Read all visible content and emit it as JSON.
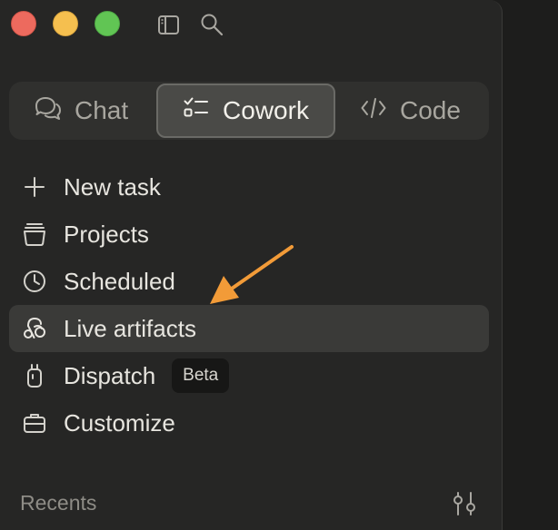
{
  "window": {
    "traffic_lights": {
      "close": "close",
      "minimize": "minimize",
      "zoom": "zoom"
    },
    "top_icons": [
      "sidebar-toggle-icon",
      "search-icon"
    ]
  },
  "modes": {
    "chat_label": "Chat",
    "cowork_label": "Cowork",
    "code_label": "Code",
    "active": "Cowork"
  },
  "nav": {
    "items": [
      {
        "label": "New task",
        "icon": "plus-icon"
      },
      {
        "label": "Projects",
        "icon": "folder-icon"
      },
      {
        "label": "Scheduled",
        "icon": "clock-icon"
      },
      {
        "label": "Live artifacts",
        "icon": "live-artifacts-icon",
        "active": true
      },
      {
        "label": "Dispatch",
        "icon": "device-icon",
        "badge": "Beta"
      },
      {
        "label": "Customize",
        "icon": "briefcase-icon"
      }
    ]
  },
  "recents": {
    "label": "Recents",
    "filter_icon": "filter-icon"
  },
  "colors": {
    "sidebar_bg": "#262625",
    "active_bg": "#3a3a38",
    "annotation_arrow": "#f29b38",
    "text": "#e7e5df",
    "muted_text": "#a8a69f"
  }
}
